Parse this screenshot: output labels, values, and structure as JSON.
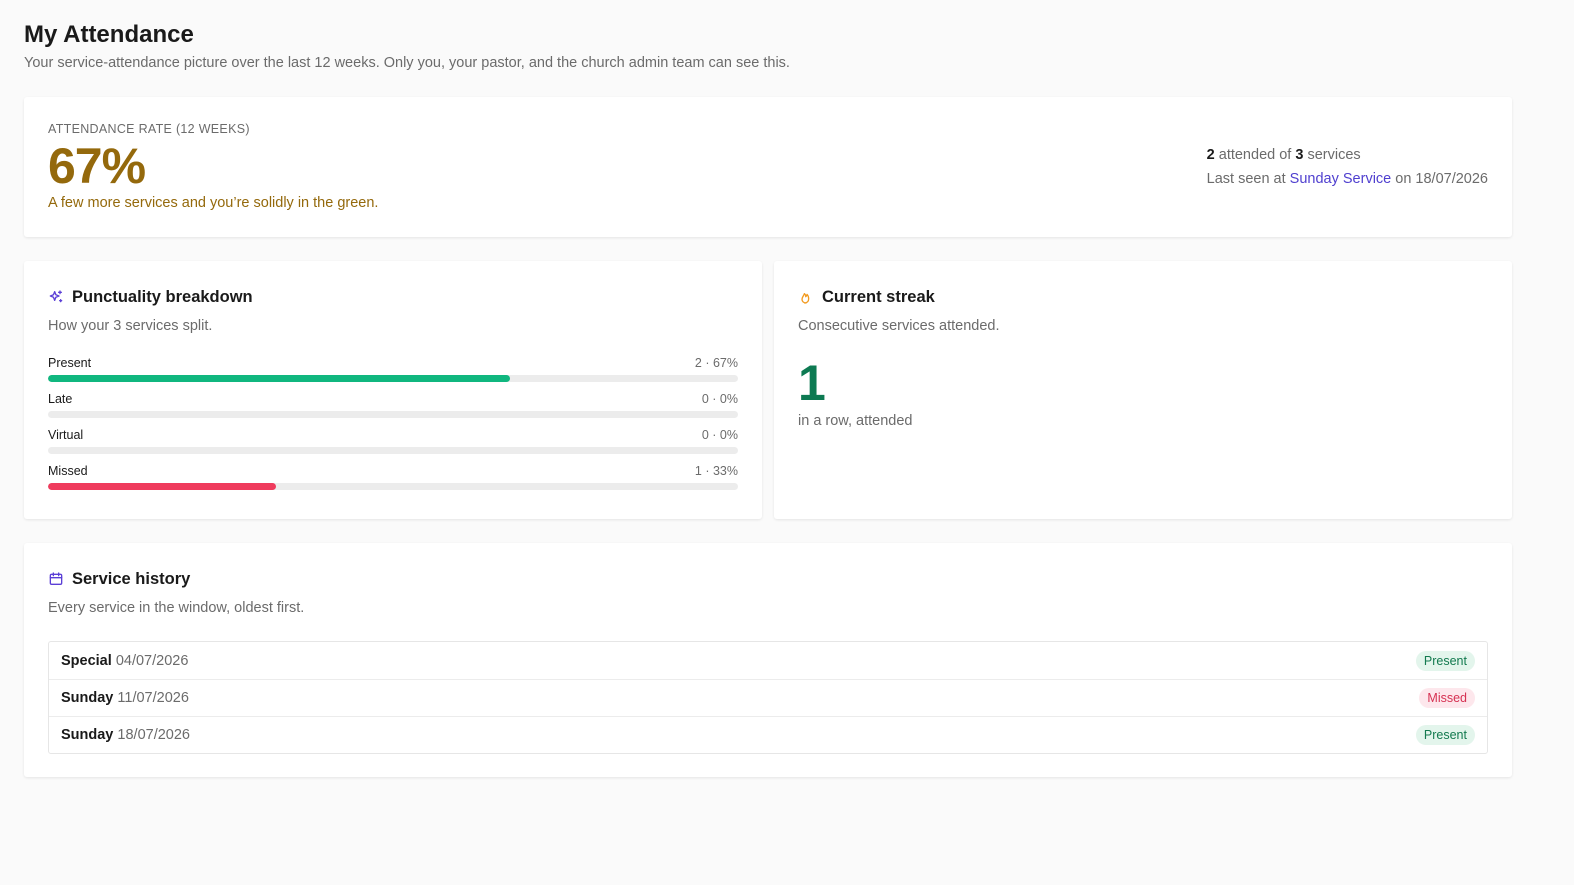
{
  "header": {
    "title": "My Attendance",
    "subtitle": "Your service-attendance picture over the last 12 weeks. Only you, your pastor, and the church admin team can see this."
  },
  "rate": {
    "label": "ATTENDANCE RATE (12 WEEKS)",
    "value": "67%",
    "message": "A few more services and you’re solidly in the green.",
    "attended": "2",
    "attended_text": "attended of",
    "total": "3",
    "total_text": "services",
    "last_seen_prefix": "Last seen at",
    "last_seen_service": "Sunday Service",
    "last_seen_suffix": "on 18/07/2026",
    "color": "#94690c"
  },
  "punctuality": {
    "icon": "sparkles-icon",
    "title": "Punctuality breakdown",
    "description": "How your 3 services split.",
    "items": [
      {
        "name": "Present",
        "value": "2 · 67%",
        "fraction": 0.67,
        "color": "#10b77f"
      },
      {
        "name": "Late",
        "value": "0 · 0%",
        "fraction": 0,
        "color": "#f5a623"
      },
      {
        "name": "Virtual",
        "value": "0 · 0%",
        "fraction": 0,
        "color": "#4f7fe8"
      },
      {
        "name": "Missed",
        "value": "1 · 33%",
        "fraction": 0.33,
        "color": "#ef3b5d"
      }
    ]
  },
  "streak": {
    "icon": "flame-icon",
    "title": "Current streak",
    "description": "Consecutive services attended.",
    "value": "1",
    "label": "in a row, attended",
    "color": "#0d7a52"
  },
  "history": {
    "icon": "calendar-icon",
    "title": "Service history",
    "description": "Every service in the window, oldest first.",
    "rows": [
      {
        "type": "Special",
        "date": "04/07/2026",
        "status": "Present"
      },
      {
        "type": "Sunday",
        "date": "11/07/2026",
        "status": "Missed"
      },
      {
        "type": "Sunday",
        "date": "18/07/2026",
        "status": "Present"
      }
    ]
  }
}
